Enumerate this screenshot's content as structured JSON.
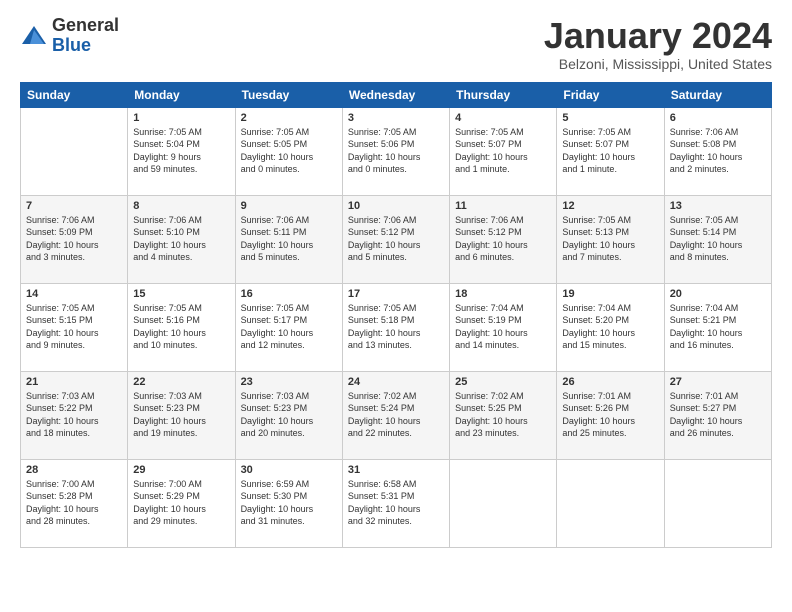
{
  "logo": {
    "general": "General",
    "blue": "Blue"
  },
  "title": "January 2024",
  "location": "Belzoni, Mississippi, United States",
  "days_of_week": [
    "Sunday",
    "Monday",
    "Tuesday",
    "Wednesday",
    "Thursday",
    "Friday",
    "Saturday"
  ],
  "weeks": [
    [
      {
        "day": "",
        "info": ""
      },
      {
        "day": "1",
        "info": "Sunrise: 7:05 AM\nSunset: 5:04 PM\nDaylight: 9 hours\nand 59 minutes."
      },
      {
        "day": "2",
        "info": "Sunrise: 7:05 AM\nSunset: 5:05 PM\nDaylight: 10 hours\nand 0 minutes."
      },
      {
        "day": "3",
        "info": "Sunrise: 7:05 AM\nSunset: 5:06 PM\nDaylight: 10 hours\nand 0 minutes."
      },
      {
        "day": "4",
        "info": "Sunrise: 7:05 AM\nSunset: 5:07 PM\nDaylight: 10 hours\nand 1 minute."
      },
      {
        "day": "5",
        "info": "Sunrise: 7:05 AM\nSunset: 5:07 PM\nDaylight: 10 hours\nand 1 minute."
      },
      {
        "day": "6",
        "info": "Sunrise: 7:06 AM\nSunset: 5:08 PM\nDaylight: 10 hours\nand 2 minutes."
      }
    ],
    [
      {
        "day": "7",
        "info": "Sunrise: 7:06 AM\nSunset: 5:09 PM\nDaylight: 10 hours\nand 3 minutes."
      },
      {
        "day": "8",
        "info": "Sunrise: 7:06 AM\nSunset: 5:10 PM\nDaylight: 10 hours\nand 4 minutes."
      },
      {
        "day": "9",
        "info": "Sunrise: 7:06 AM\nSunset: 5:11 PM\nDaylight: 10 hours\nand 5 minutes."
      },
      {
        "day": "10",
        "info": "Sunrise: 7:06 AM\nSunset: 5:12 PM\nDaylight: 10 hours\nand 5 minutes."
      },
      {
        "day": "11",
        "info": "Sunrise: 7:06 AM\nSunset: 5:12 PM\nDaylight: 10 hours\nand 6 minutes."
      },
      {
        "day": "12",
        "info": "Sunrise: 7:05 AM\nSunset: 5:13 PM\nDaylight: 10 hours\nand 7 minutes."
      },
      {
        "day": "13",
        "info": "Sunrise: 7:05 AM\nSunset: 5:14 PM\nDaylight: 10 hours\nand 8 minutes."
      }
    ],
    [
      {
        "day": "14",
        "info": "Sunrise: 7:05 AM\nSunset: 5:15 PM\nDaylight: 10 hours\nand 9 minutes."
      },
      {
        "day": "15",
        "info": "Sunrise: 7:05 AM\nSunset: 5:16 PM\nDaylight: 10 hours\nand 10 minutes."
      },
      {
        "day": "16",
        "info": "Sunrise: 7:05 AM\nSunset: 5:17 PM\nDaylight: 10 hours\nand 12 minutes."
      },
      {
        "day": "17",
        "info": "Sunrise: 7:05 AM\nSunset: 5:18 PM\nDaylight: 10 hours\nand 13 minutes."
      },
      {
        "day": "18",
        "info": "Sunrise: 7:04 AM\nSunset: 5:19 PM\nDaylight: 10 hours\nand 14 minutes."
      },
      {
        "day": "19",
        "info": "Sunrise: 7:04 AM\nSunset: 5:20 PM\nDaylight: 10 hours\nand 15 minutes."
      },
      {
        "day": "20",
        "info": "Sunrise: 7:04 AM\nSunset: 5:21 PM\nDaylight: 10 hours\nand 16 minutes."
      }
    ],
    [
      {
        "day": "21",
        "info": "Sunrise: 7:03 AM\nSunset: 5:22 PM\nDaylight: 10 hours\nand 18 minutes."
      },
      {
        "day": "22",
        "info": "Sunrise: 7:03 AM\nSunset: 5:23 PM\nDaylight: 10 hours\nand 19 minutes."
      },
      {
        "day": "23",
        "info": "Sunrise: 7:03 AM\nSunset: 5:23 PM\nDaylight: 10 hours\nand 20 minutes."
      },
      {
        "day": "24",
        "info": "Sunrise: 7:02 AM\nSunset: 5:24 PM\nDaylight: 10 hours\nand 22 minutes."
      },
      {
        "day": "25",
        "info": "Sunrise: 7:02 AM\nSunset: 5:25 PM\nDaylight: 10 hours\nand 23 minutes."
      },
      {
        "day": "26",
        "info": "Sunrise: 7:01 AM\nSunset: 5:26 PM\nDaylight: 10 hours\nand 25 minutes."
      },
      {
        "day": "27",
        "info": "Sunrise: 7:01 AM\nSunset: 5:27 PM\nDaylight: 10 hours\nand 26 minutes."
      }
    ],
    [
      {
        "day": "28",
        "info": "Sunrise: 7:00 AM\nSunset: 5:28 PM\nDaylight: 10 hours\nand 28 minutes."
      },
      {
        "day": "29",
        "info": "Sunrise: 7:00 AM\nSunset: 5:29 PM\nDaylight: 10 hours\nand 29 minutes."
      },
      {
        "day": "30",
        "info": "Sunrise: 6:59 AM\nSunset: 5:30 PM\nDaylight: 10 hours\nand 31 minutes."
      },
      {
        "day": "31",
        "info": "Sunrise: 6:58 AM\nSunset: 5:31 PM\nDaylight: 10 hours\nand 32 minutes."
      },
      {
        "day": "",
        "info": ""
      },
      {
        "day": "",
        "info": ""
      },
      {
        "day": "",
        "info": ""
      }
    ]
  ]
}
